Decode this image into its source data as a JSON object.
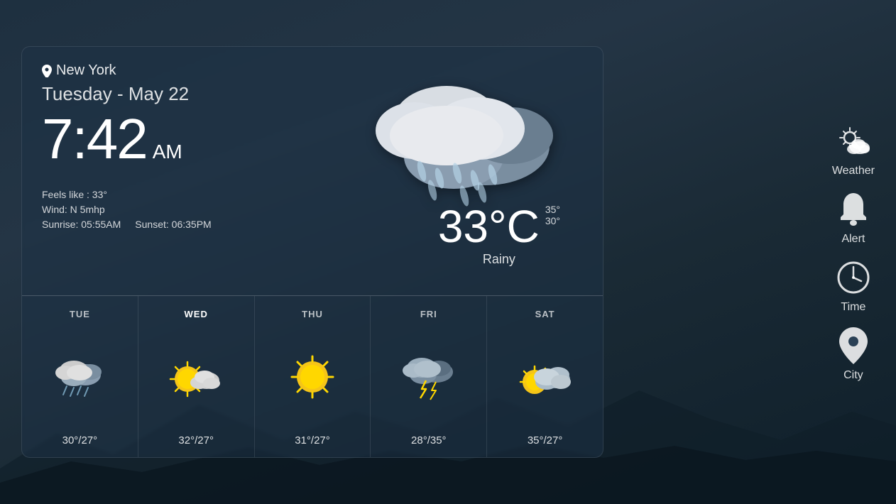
{
  "background": {
    "color_top": "#1e3040",
    "color_bottom": "#0f1f2a"
  },
  "location": {
    "pin_icon": "📍",
    "name": "New York"
  },
  "date": "Tuesday - May 22",
  "time": {
    "value": "7:42",
    "ampm": "AM"
  },
  "weather": {
    "feels_like": "Feels like : 33°",
    "wind": "Wind: N 5mhp",
    "sunrise": "Sunrise: 05:55AM",
    "sunset": "Sunset: 06:35PM",
    "temp": "33°C",
    "temp_high": "35°",
    "temp_low": "30°",
    "condition": "Rainy"
  },
  "forecast": [
    {
      "day": "TUE",
      "active": false,
      "temps": "30°/27°",
      "icon": "rainy"
    },
    {
      "day": "WED",
      "active": true,
      "temps": "32°/27°",
      "icon": "sunny_cloudy"
    },
    {
      "day": "THU",
      "active": false,
      "temps": "31°/27°",
      "icon": "sunny"
    },
    {
      "day": "FRI",
      "active": false,
      "temps": "28°/35°",
      "icon": "stormy"
    },
    {
      "day": "SAT",
      "active": false,
      "temps": "35°/27°",
      "icon": "partly_cloudy"
    }
  ],
  "sidebar": [
    {
      "id": "weather",
      "label": "Weather",
      "icon": "weather"
    },
    {
      "id": "alert",
      "label": "Alert",
      "icon": "bell"
    },
    {
      "id": "time",
      "label": "Time",
      "icon": "clock"
    },
    {
      "id": "city",
      "label": "City",
      "icon": "pin"
    }
  ]
}
